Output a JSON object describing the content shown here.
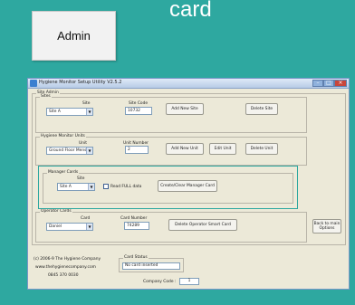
{
  "slide": {
    "title": "card",
    "admin_button": "Admin"
  },
  "window": {
    "title": "Hygiene Monitor Setup Utility   V2.5.2",
    "controls": {
      "minimize": "–",
      "maximize": "□",
      "close": "×"
    }
  },
  "site_admin": {
    "legend": "Site Admin",
    "sites": {
      "legend": "Sites",
      "site_label": "Site",
      "site_value": "Site A",
      "site_code_label": "Site Code",
      "site_code_value": "10732",
      "add_button": "Add New Site",
      "delete_button": "Delete Site"
    },
    "units": {
      "legend": "Hygiene Monitor Units",
      "unit_label": "Unit",
      "unit_value": "Ground Floor Mens",
      "unit_number_label": "Unit Number",
      "unit_number_value": "2",
      "add_button": "Add New Unit",
      "edit_button": "Edit Unit",
      "delete_button": "Delete Unit"
    },
    "manager_cards": {
      "legend": "Manager Cards",
      "site_label": "Site",
      "site_value": "Site A",
      "read_full_label": "Read FULL data",
      "create_button": "Create/Clear Manager Card"
    },
    "operator_cards": {
      "legend": "Operator Cards",
      "card_label": "Card",
      "card_value": "Daniel",
      "card_number_label": "Card Number",
      "card_number_value": "74289",
      "delete_button": "Delete Operator Smart  Card"
    },
    "back_button_line1": "Back to main",
    "back_button_line2": "Options"
  },
  "footer": {
    "copyright": "(c) 2006-9 The Hygiene Company",
    "website": "www.thehygienecompany.com",
    "phone": "0845 370 0030",
    "card_status_legend": "Card Status",
    "card_status_value": "No card inserted",
    "company_code_label": "Company Code :",
    "company_code_value": "1"
  },
  "colors": {
    "slide_background": "#2ea8a0",
    "window_background": "#ece9d8",
    "highlight_border": "#2ea8a0"
  }
}
